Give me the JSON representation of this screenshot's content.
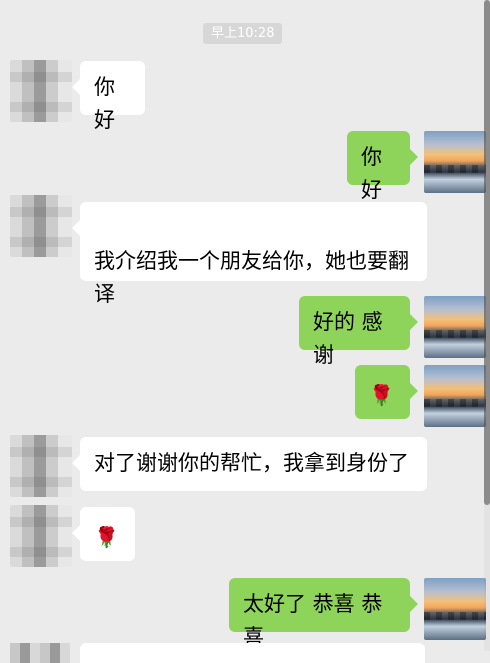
{
  "chat": {
    "timestamp": "早上10:28",
    "messages": [
      {
        "text": "你好"
      },
      {
        "text": "你好"
      },
      {
        "text": "我介绍我一个朋友给你，她也要翻\n译"
      },
      {
        "text": "好的 感谢"
      },
      {
        "text": "🌹"
      },
      {
        "text": "对了谢谢你的帮忙，我拿到身份了"
      },
      {
        "text": "🌹"
      },
      {
        "text": "太好了 恭喜 恭喜"
      }
    ]
  },
  "icons": {
    "rose_icon": "rose-icon"
  },
  "colors": {
    "background": "#ebebeb",
    "incoming_bubble": "#ffffff",
    "outgoing_bubble": "#8fd45a",
    "timestamp_bg": "#d7d7d7"
  }
}
